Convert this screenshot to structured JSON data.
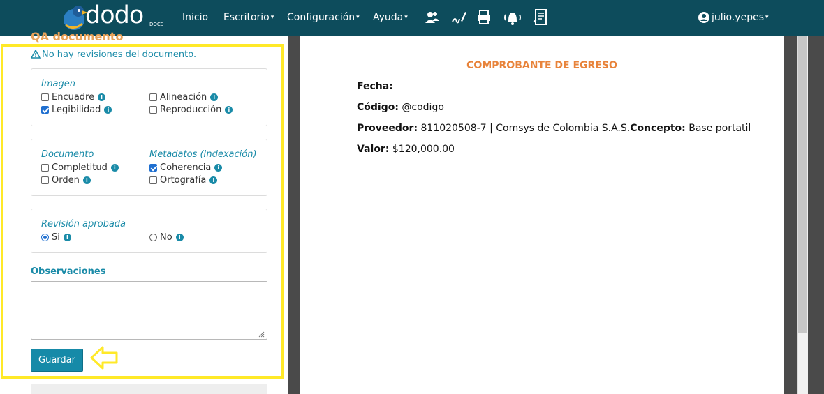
{
  "navbar": {
    "logo_text": "dodo",
    "logo_sub": "DOCS",
    "menu": [
      {
        "label": "Inicio"
      },
      {
        "label": "Escritorio"
      },
      {
        "label": "Configuración"
      },
      {
        "label": "Ayuda"
      }
    ],
    "icons": [
      "users-icon",
      "signature-icon",
      "printer-icon",
      "bell-icon",
      "report-icon"
    ],
    "user": "julio.yepes"
  },
  "qa": {
    "title": "QA documento",
    "warning": "No hay revisiones del documento.",
    "imagen": {
      "title": "Imagen",
      "options": [
        {
          "label": "Encuadre",
          "checked": false
        },
        {
          "label": "Alineación",
          "checked": false
        },
        {
          "label": "Legibilidad",
          "checked": true
        },
        {
          "label": "Reproducción",
          "checked": false
        }
      ]
    },
    "documento": {
      "title": "Documento",
      "options": [
        {
          "label": "Completitud",
          "checked": false
        },
        {
          "label": "Orden",
          "checked": false
        }
      ]
    },
    "metadatos": {
      "title": "Metadatos (Indexación)",
      "options": [
        {
          "label": "Coherencia",
          "checked": true
        },
        {
          "label": "Ortografía",
          "checked": false
        }
      ]
    },
    "revision": {
      "title": "Revisión aprobada",
      "yes": "Si",
      "no": "No",
      "selected": "Si"
    },
    "observaciones_label": "Observaciones",
    "observaciones_value": "",
    "save_label": "Guardar"
  },
  "document": {
    "title": "COMPROBANTE DE EGRESO",
    "fecha_label": "Fecha:",
    "fecha_value": "",
    "codigo_label": "Código:",
    "codigo_value": "@codigo",
    "proveedor_label": "Proveedor:",
    "proveedor_value": "811020508-7 | Comsys de Colombia S.A.S.",
    "concepto_label": "Concepto:",
    "concepto_value": "Base portatil",
    "valor_label": "Valor:",
    "valor_value": "$120,000.00"
  },
  "colors": {
    "navbar": "#0d4c5c",
    "accent": "#1a8ba8",
    "highlight": "#ffe928",
    "doc_title": "#e8833a"
  }
}
